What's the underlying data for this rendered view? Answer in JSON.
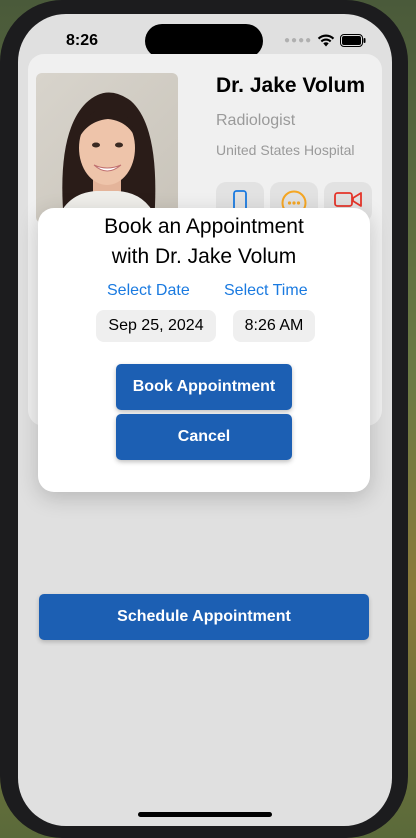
{
  "status_bar": {
    "time": "8:26",
    "wifi_icon": "wifi-icon",
    "battery_icon": "battery-icon"
  },
  "doctor": {
    "name": "Dr. Jake Volum",
    "specialty": "Radiologist",
    "hospital": "United States Hospital",
    "photo_icon": "doctor-portrait",
    "contact_icons": [
      "phone-icon",
      "message-icon",
      "video-icon"
    ]
  },
  "booking_modal": {
    "title_line1": "Book an Appointment",
    "title_line2": "with Dr. Jake Volum",
    "select_date_label": "Select Date",
    "select_time_label": "Select Time",
    "date_value": "Sep 25, 2024",
    "time_value": "8:26 AM",
    "book_button_label": "Book Appointment",
    "cancel_button_label": "Cancel"
  },
  "schedule_button_label": "Schedule Appointment",
  "colors": {
    "accent": "#1c5fb3",
    "link": "#1a7ae0",
    "video": "#e5352a",
    "message": "#f5a623"
  }
}
